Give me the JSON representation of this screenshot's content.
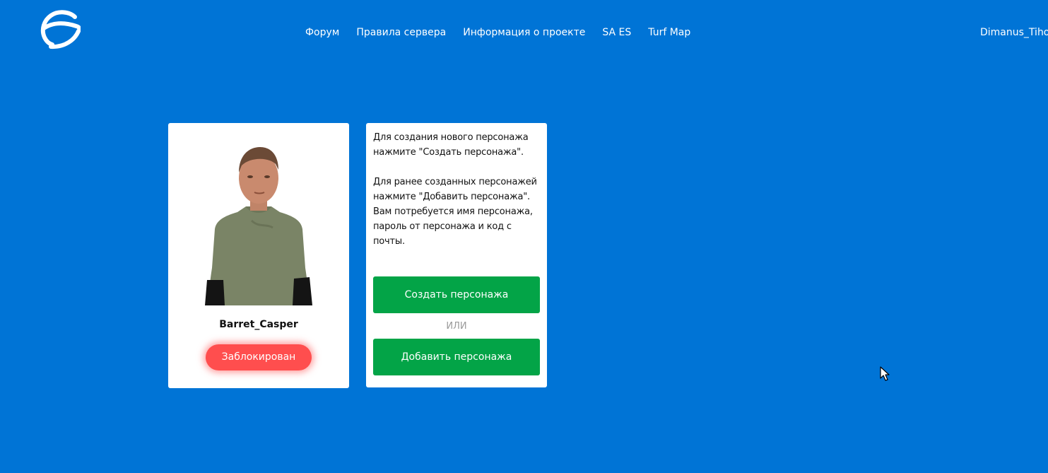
{
  "header": {
    "nav": [
      {
        "label": "Форум"
      },
      {
        "label": "Правила сервера"
      },
      {
        "label": "Информация о проекте"
      },
      {
        "label": "SA ES"
      },
      {
        "label": "Turf Map"
      }
    ],
    "user_name": "Dimanus_Tiho"
  },
  "character": {
    "name": "Barret_Casper",
    "status": "Заблокирован"
  },
  "info": {
    "paragraph1": "Для создания нового персонажа нажмите \"Создать персонажа\".",
    "paragraph2": "Для ранее созданных персонажей нажмите \"Добавить персонажа\". Вам потребуется имя персонажа, пароль от персонажа и код с почты.",
    "create_button": "Создать персонажа",
    "or_label": "ИЛИ",
    "add_button": "Добавить персонажа"
  },
  "colors": {
    "background": "#0074d6",
    "primary_button": "#03a447",
    "status_banned": "#ff4e4e"
  }
}
